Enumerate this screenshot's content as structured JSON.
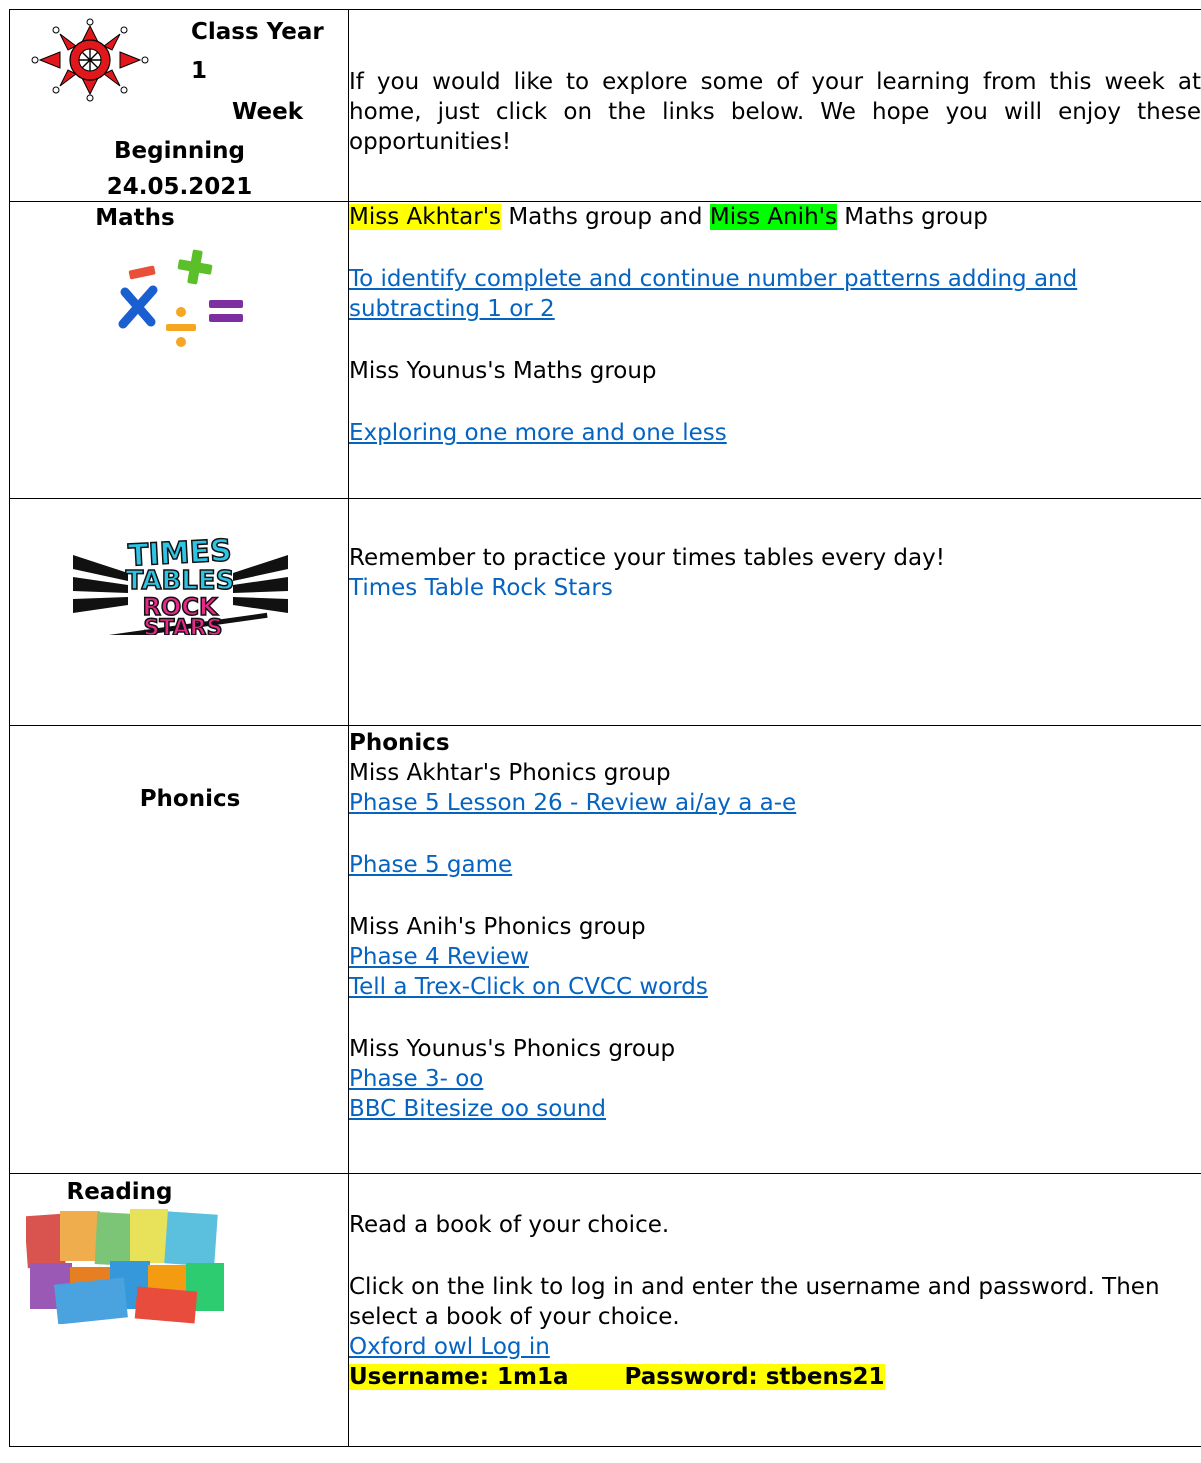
{
  "header": {
    "title_line1": "Class Year",
    "title_line2": "1",
    "title_line3": "Week",
    "title_line4": "Beginning",
    "date": "24.05.2021",
    "intro": "If you would like to explore some of your learning from this week at home, just click on the links below. We hope you will enjoy these opportunities!"
  },
  "maths": {
    "label": "Maths",
    "teacher1": "Miss Akhtar's",
    "and_text": "Maths group and",
    "teacher2": "Miss Anih's",
    "group_text": "Maths group",
    "link1": "To identify complete and continue number patterns adding and subtracting 1 or 2",
    "group2": "Miss Younus's Maths group",
    "link2": "Exploring one more and one less"
  },
  "ttrs": {
    "logo_text": "TIMES TABLES ROCK STARS",
    "reminder": "Remember to practice your times tables every day!",
    "link": "Times Table Rock Stars"
  },
  "phonics": {
    "label": "Phonics",
    "heading": "Phonics",
    "group1": "Miss Akhtar's Phonics group",
    "link1": "Phase 5 Lesson 26 - Review ai/ay a a-e",
    "link2": "Phase 5 game",
    "group2": "Miss Anih's Phonics group",
    "link3": "Phase 4 Review",
    "link4": "Tell a Trex-Click on CVCC words",
    "group3": "Miss Younus's Phonics group",
    "link5": "Phase 3- oo",
    "link6": "BBC Bitesize oo sound"
  },
  "reading": {
    "label": "Reading",
    "line1": "Read a book of your choice.",
    "line2": "Click on the link to log in and enter the username and password. Then select a book of your choice.",
    "link": "Oxford owl Log in",
    "username": "Username: 1m1a",
    "password": "Password: stbens21"
  },
  "colors": {
    "link": "#0563c1",
    "highlight_yellow": "#ffff00",
    "highlight_green": "#00ff00",
    "logo_red": "#e0181b"
  }
}
